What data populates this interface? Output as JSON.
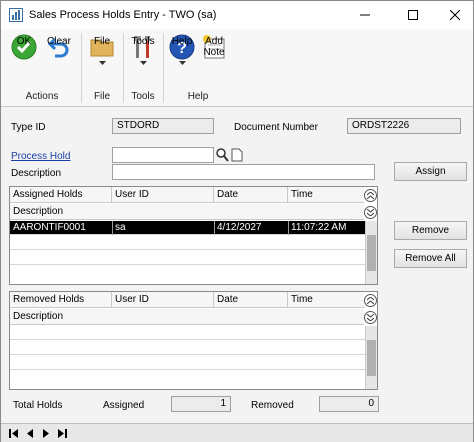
{
  "window": {
    "title": "Sales Process Holds Entry  -  TWO (sa)"
  },
  "ribbon": {
    "ok": "OK",
    "clear": "Clear",
    "file": "File",
    "tools": "Tools",
    "help": "Help",
    "add_note": "Add Note",
    "groups": {
      "actions": "Actions",
      "file": "File",
      "tools": "Tools",
      "help": "Help"
    }
  },
  "form": {
    "type_id_label": "Type ID",
    "type_id_value": "STDORD",
    "document_number_label": "Document Number",
    "document_number_value": "ORDST2226",
    "process_hold_label": "Process Hold",
    "process_hold_value": "",
    "description_label": "Description",
    "description_value": ""
  },
  "buttons": {
    "assign": "Assign",
    "remove": "Remove",
    "remove_all": "Remove All"
  },
  "assigned_grid": {
    "headers": [
      "Assigned Holds",
      "User ID",
      "Date",
      "Time"
    ],
    "sub_header": "Description",
    "rows": [
      {
        "hold": "AARONTIF0001",
        "user": "sa",
        "date": "4/12/2027",
        "time": "11:07:22 AM"
      }
    ]
  },
  "removed_grid": {
    "headers": [
      "Removed Holds",
      "User ID",
      "Date",
      "Time"
    ],
    "sub_header": "Description",
    "rows": []
  },
  "totals": {
    "total_holds_label": "Total Holds",
    "assigned_label": "Assigned",
    "assigned_value": "1",
    "removed_label": "Removed",
    "removed_value": "0"
  }
}
